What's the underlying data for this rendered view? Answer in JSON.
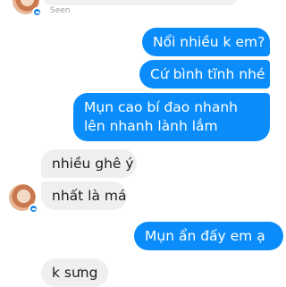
{
  "seen_label": "Seen",
  "messages": [
    {
      "sender": "me",
      "text": "Nổi nhiều k em?"
    },
    {
      "sender": "me",
      "text": "Cứ bình tĩnh nhé"
    },
    {
      "sender": "me",
      "text": "Mụn cao bí đao nhanh lên nhanh lành lắm"
    },
    {
      "sender": "other",
      "text": "nhiều ghê ý"
    },
    {
      "sender": "other",
      "text": "nhất là má"
    },
    {
      "sender": "me",
      "text": "Mụn ẩn đấy em ạ"
    },
    {
      "sender": "other",
      "text": "k sưng"
    }
  ],
  "colors": {
    "outgoing_bubble": "#0a8dfb",
    "incoming_bubble": "#efefef",
    "outgoing_text": "#ffffff",
    "incoming_text": "#1c1c1c",
    "badge": "#1e88e5"
  }
}
